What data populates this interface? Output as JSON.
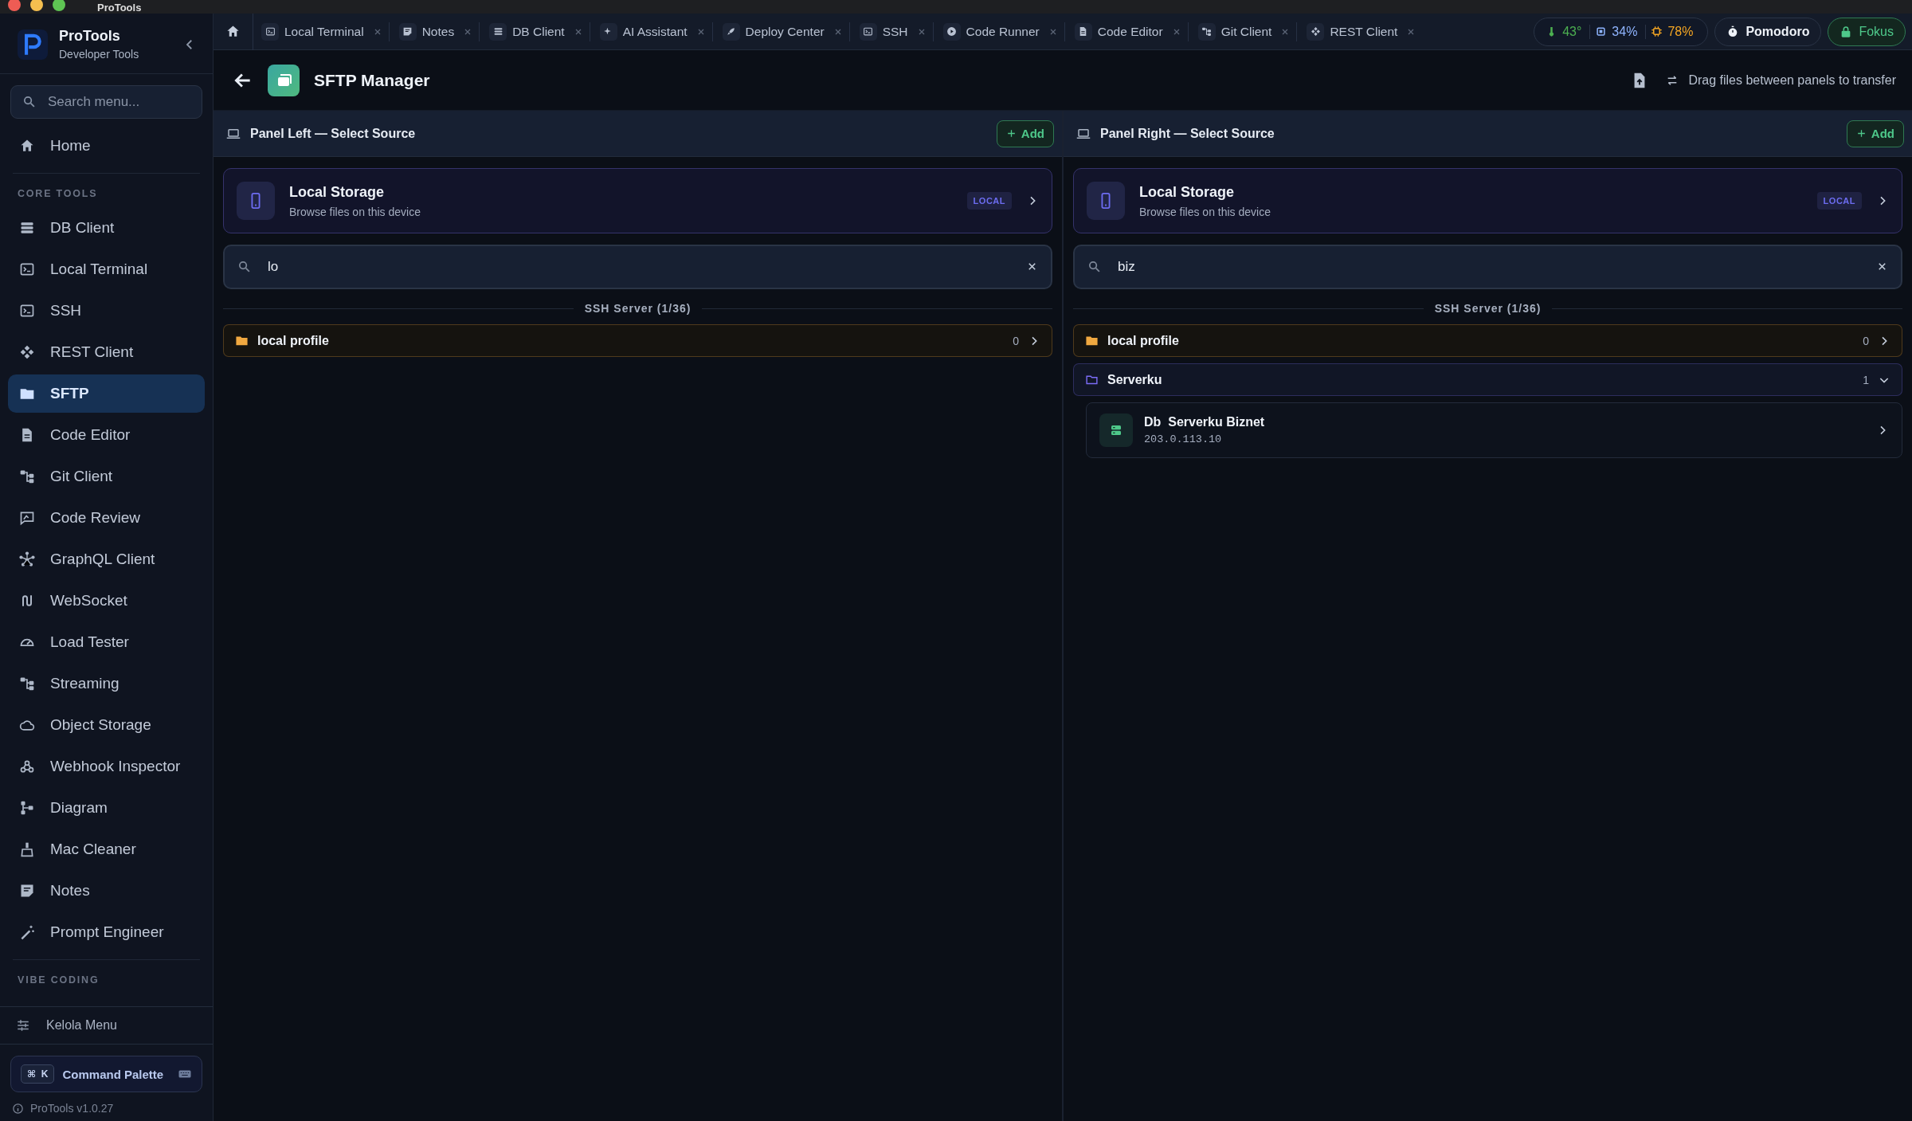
{
  "window": {
    "title": "ProTools"
  },
  "sidebar": {
    "app_name": "ProTools",
    "app_subtitle": "Developer Tools",
    "search": {
      "placeholder": "Search menu..."
    },
    "home": {
      "label": "Home",
      "selected": false
    },
    "sections": [
      {
        "label": "CORE TOOLS",
        "items": [
          {
            "label": "DB Client",
            "selected": false
          },
          {
            "label": "Local Terminal",
            "selected": false
          },
          {
            "label": "SSH",
            "selected": false
          },
          {
            "label": "REST Client",
            "selected": false
          },
          {
            "label": "SFTP",
            "selected": true
          },
          {
            "label": "Code Editor",
            "selected": false
          },
          {
            "label": "Git Client",
            "selected": false
          },
          {
            "label": "Code Review",
            "selected": false
          },
          {
            "label": "GraphQL Client",
            "selected": false
          },
          {
            "label": "WebSocket",
            "selected": false
          },
          {
            "label": "Load Tester",
            "selected": false
          },
          {
            "label": "Streaming",
            "selected": false
          },
          {
            "label": "Object Storage",
            "selected": false
          },
          {
            "label": "Webhook Inspector",
            "selected": false
          },
          {
            "label": "Diagram",
            "selected": false
          },
          {
            "label": "Mac Cleaner",
            "selected": false
          },
          {
            "label": "Notes",
            "selected": false
          },
          {
            "label": "Prompt Engineer",
            "selected": false
          }
        ]
      },
      {
        "label": "VIBE CODING"
      }
    ],
    "manage_menu": "Kelola Menu",
    "command_palette": {
      "keys": [
        "⌘",
        "K"
      ],
      "label": "Command Palette"
    },
    "version": "ProTools v1.0.27"
  },
  "tabs": [
    {
      "label": "Local Terminal",
      "selected": false
    },
    {
      "label": "Notes",
      "selected": false
    },
    {
      "label": "DB Client",
      "selected": false
    },
    {
      "label": "AI Assistant",
      "selected": false
    },
    {
      "label": "Deploy Center",
      "selected": false
    },
    {
      "label": "SSH",
      "selected": false
    },
    {
      "label": "Code Runner",
      "selected": false
    },
    {
      "label": "Code Editor",
      "selected": false
    },
    {
      "label": "Git Client",
      "selected": false
    },
    {
      "label": "REST Client",
      "selected": false
    }
  ],
  "stats": [
    {
      "value": "43°",
      "color": "#4caf50"
    },
    {
      "value": "34%",
      "color": "#8fb4ff"
    },
    {
      "value": "78%",
      "color": "#f5a623"
    }
  ],
  "pomodoro": "Pomodoro",
  "focus": "Fokus",
  "header": {
    "title": "SFTP Manager",
    "hint": "Drag files between panels to transfer"
  },
  "panels": [
    {
      "title": "Panel Left — Select Source",
      "add": "Add",
      "source": {
        "title": "Local Storage",
        "subtitle": "Browse files on this device",
        "badge": "LOCAL"
      },
      "search": "lo",
      "group_label": "SSH Server (1/36)",
      "rows": [
        {
          "kind": "folder",
          "name": "local profile",
          "count": "0",
          "color": "#f0a840",
          "expanded": false
        }
      ]
    },
    {
      "title": "Panel Right — Select Source",
      "add": "Add",
      "source": {
        "title": "Local Storage",
        "subtitle": "Browse files on this device",
        "badge": "LOCAL"
      },
      "search": "biz",
      "group_label": "SSH Server (1/36)",
      "rows": [
        {
          "kind": "folder",
          "name": "local profile",
          "count": "0",
          "color": "#f0a840",
          "expanded": false
        },
        {
          "kind": "folder",
          "name": "Serverku",
          "count": "1",
          "color": "#7b6cf6",
          "expanded": true,
          "children": [
            {
              "kind": "server",
              "name": "Db  Serverku Biznet",
              "address": "203.0.113.10"
            }
          ]
        }
      ]
    }
  ]
}
